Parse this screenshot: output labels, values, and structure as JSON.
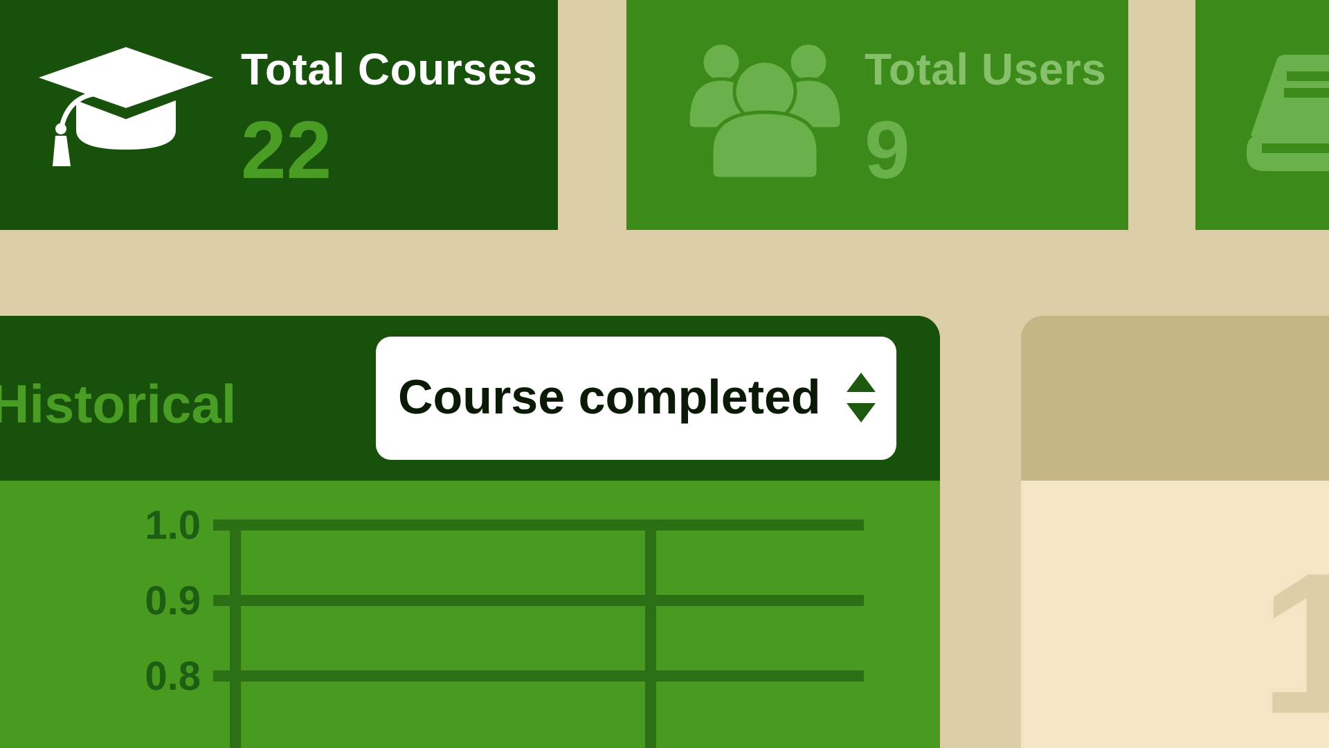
{
  "stats": {
    "courses": {
      "label": "Total Courses",
      "value": "22",
      "icon": "graduation-cap-icon"
    },
    "users": {
      "label": "Total Users",
      "value": "9",
      "icon": "users-group-icon"
    },
    "third": {
      "icon": "book-icon"
    }
  },
  "historical": {
    "title": "Historical",
    "metric_select": {
      "selected": "Course completed",
      "icon": "sort-arrows-icon"
    }
  },
  "chart_data": {
    "type": "line",
    "y_ticks": [
      "1.0",
      "0.9",
      "0.8"
    ],
    "yvalues": [
      1.0,
      0.9,
      0.8
    ],
    "ylim": [
      0.8,
      1.0
    ],
    "grid": true,
    "series": []
  },
  "right_panel": {
    "value": "1"
  },
  "colors": {
    "background": "#dccea6",
    "dark_green": "#17510b",
    "mid_green": "#3c8a1a",
    "bright_green": "#489b20",
    "tan": "#c4b685",
    "cream": "#f2e6c4"
  }
}
